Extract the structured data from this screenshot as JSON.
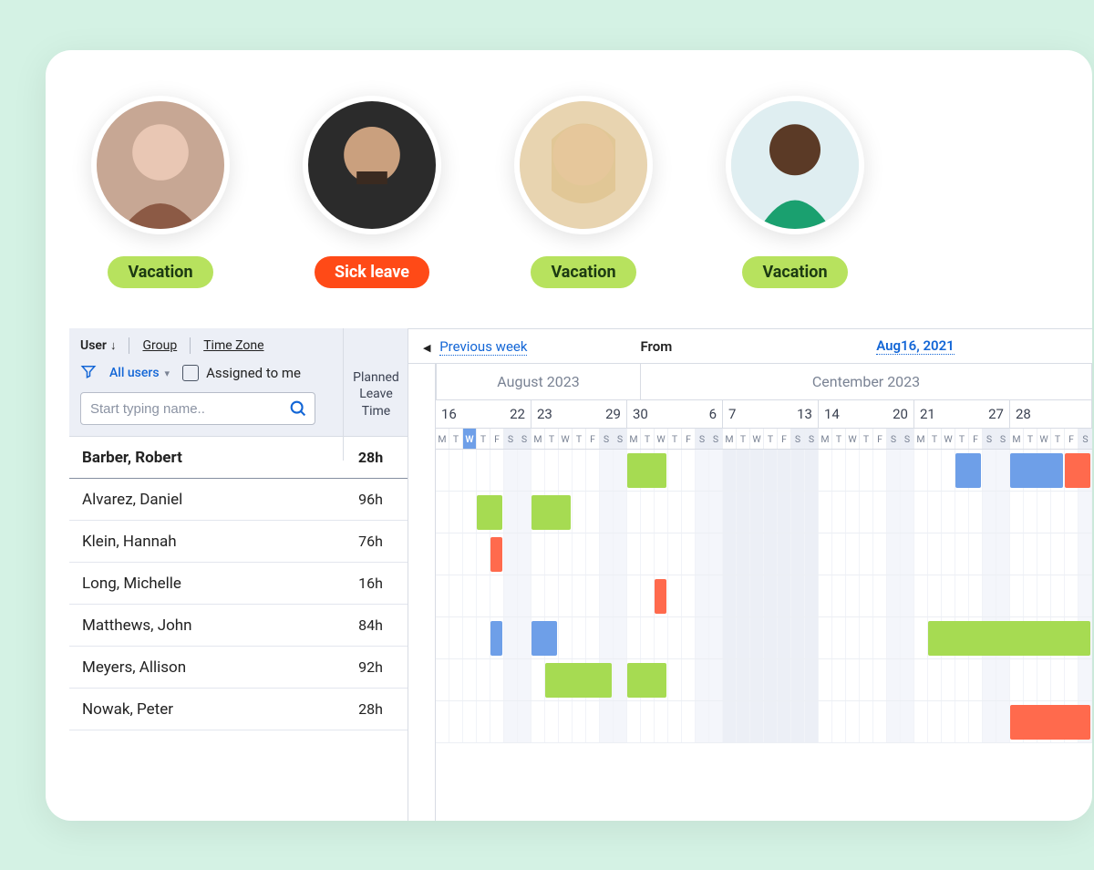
{
  "avatars": [
    {
      "status_label": "Vacation",
      "status_type": "vacation"
    },
    {
      "status_label": "Sick leave",
      "status_type": "sick"
    },
    {
      "status_label": "Vacation",
      "status_type": "vacation"
    },
    {
      "status_label": "Vacation",
      "status_type": "vacation"
    }
  ],
  "filters": {
    "user_label": "User",
    "group_label": "Group",
    "timezone_label": "Time Zone",
    "allusers_label": "All users",
    "assigned_label": "Assigned to me",
    "planned_leave_header": "Planned Leave Time",
    "search_placeholder": "Start typing name.."
  },
  "nav": {
    "prev_week": "Previous week",
    "from_label": "From",
    "date": "Aug16, 2021"
  },
  "months": [
    {
      "label": "August 2023",
      "span_days": 15
    },
    {
      "label": "Centember 2023",
      "span_days": 33
    }
  ],
  "weeks": [
    {
      "start": "16",
      "end": "22",
      "days": 7
    },
    {
      "start": "23",
      "end": "29",
      "days": 7
    },
    {
      "start": "30",
      "end": "6",
      "days": 7
    },
    {
      "start": "7",
      "end": "13",
      "days": 7
    },
    {
      "start": "14",
      "end": "20",
      "days": 7
    },
    {
      "start": "21",
      "end": "27",
      "days": 7
    },
    {
      "start": "28",
      "end": "",
      "days": 6
    }
  ],
  "day_pattern": [
    "M",
    "T",
    "W",
    "T",
    "F",
    "S",
    "S"
  ],
  "weekend_idx": [
    5,
    6
  ],
  "today_idx": 2,
  "off_week_idx": 3,
  "users": [
    {
      "name": "Barber, Robert",
      "hours": "28h",
      "selected": true,
      "blocks": [
        {
          "type": "vac",
          "start": 14,
          "len": 3
        },
        {
          "type": "other",
          "start": 38,
          "len": 2
        },
        {
          "type": "other",
          "start": 42,
          "len": 4
        },
        {
          "type": "sick",
          "start": 46,
          "len": 2
        }
      ]
    },
    {
      "name": "Alvarez, Daniel",
      "hours": "96h",
      "blocks": [
        {
          "type": "vac",
          "start": 3,
          "len": 2
        },
        {
          "type": "vac",
          "start": 7,
          "len": 3
        }
      ]
    },
    {
      "name": "Klein, Hannah",
      "hours": "76h",
      "blocks": [
        {
          "type": "sick",
          "start": 4,
          "len": 1
        }
      ]
    },
    {
      "name": "Long, Michelle",
      "hours": "16h",
      "blocks": [
        {
          "type": "sick",
          "start": 16,
          "len": 1
        }
      ]
    },
    {
      "name": "Matthews, John",
      "hours": "84h",
      "blocks": [
        {
          "type": "other",
          "start": 4,
          "len": 1
        },
        {
          "type": "other",
          "start": 7,
          "len": 2
        },
        {
          "type": "vac",
          "start": 36,
          "len": 12
        }
      ]
    },
    {
      "name": "Meyers, Allison",
      "hours": "92h",
      "blocks": [
        {
          "type": "vac",
          "start": 8,
          "len": 5
        },
        {
          "type": "vac",
          "start": 14,
          "len": 3
        }
      ]
    },
    {
      "name": "Nowak, Peter",
      "hours": "28h",
      "blocks": [
        {
          "type": "sick",
          "start": 42,
          "len": 6
        }
      ]
    }
  ],
  "colors": {
    "vacation": "#a6db52",
    "sick": "#ff6a4d",
    "other": "#6e9fe8",
    "badge_vacation": "#b7e25e",
    "badge_sick": "#ff4a17",
    "link": "#1366d6"
  }
}
